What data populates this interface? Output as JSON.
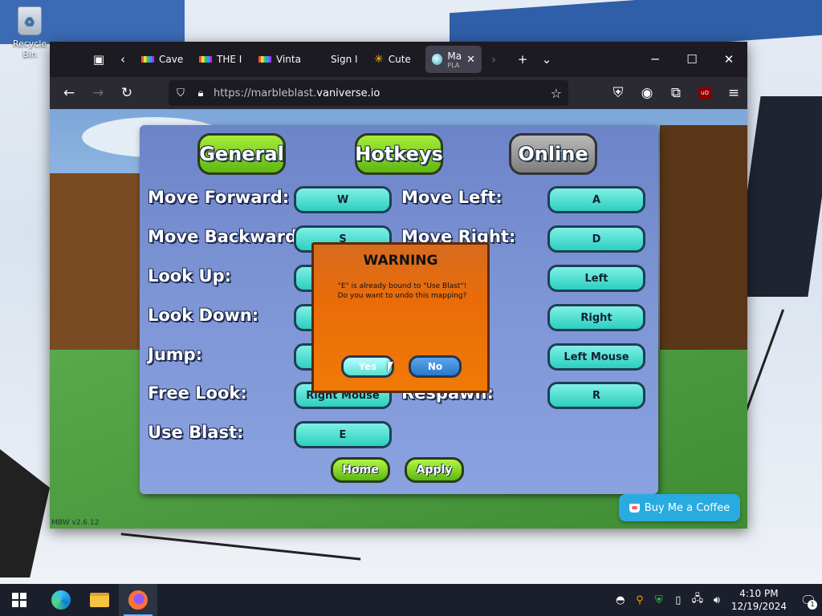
{
  "desktop": {
    "recycle_bin_label": "Recycle Bin"
  },
  "browser": {
    "tabs": [
      {
        "label": "Cave",
        "icon": "rainbow-favicon"
      },
      {
        "label": "THE I",
        "icon": "rainbow-favicon"
      },
      {
        "label": "Vinta",
        "icon": "rainbow-favicon"
      },
      {
        "label": "Sign I",
        "icon": "blank-favicon"
      },
      {
        "label": "Cute",
        "icon": "walmart-favicon"
      },
      {
        "label": "Ma",
        "sublabel": "PLA",
        "icon": "marble-favicon",
        "active": true
      }
    ],
    "url_prefix": "https://marbleblast.",
    "url_domain": "vaniverse.io",
    "colors": {
      "tabbar": "#1c1b22",
      "navbar": "#2b2a33"
    }
  },
  "game": {
    "tabs": {
      "general": "General",
      "hotkeys": "Hotkeys",
      "online": "Online"
    },
    "labels": {
      "move_forward": "Move Forward:",
      "move_backward": "Move Backward:",
      "look_up": "Look Up:",
      "look_down": "Look Down:",
      "jump": "Jump:",
      "free_look": "Free Look:",
      "use_blast": "Use Blast:",
      "move_left": "Move Left:",
      "move_right": "Move Right:",
      "respawn": "Respawn:"
    },
    "keys": {
      "move_forward": "W",
      "move_backward": "S",
      "free_look": "Right Mouse",
      "use_blast": "E",
      "move_left": "A",
      "move_right": "D",
      "right_col_3": "Left",
      "right_col_4": "Right",
      "right_col_5": "Left Mouse",
      "respawn": "R"
    },
    "buttons": {
      "home": "Home",
      "apply": "Apply"
    },
    "version": "MBW v2.6.12",
    "dialog": {
      "title": "WARNING",
      "line1": "\"E\" is already bound to \"Use Blast\"!",
      "line2": "Do you want to undo this mapping?",
      "yes": "Yes",
      "no": "No"
    },
    "colors": {
      "panel": "#7f96d6",
      "key_button": "#2ccfbf",
      "green_button": "#5fb812",
      "dialog": "#ea6c08"
    }
  },
  "coffee_button": "Buy Me a Coffee",
  "taskbar": {
    "time": "4:10 PM",
    "date": "12/19/2024",
    "notification_count": "1"
  }
}
